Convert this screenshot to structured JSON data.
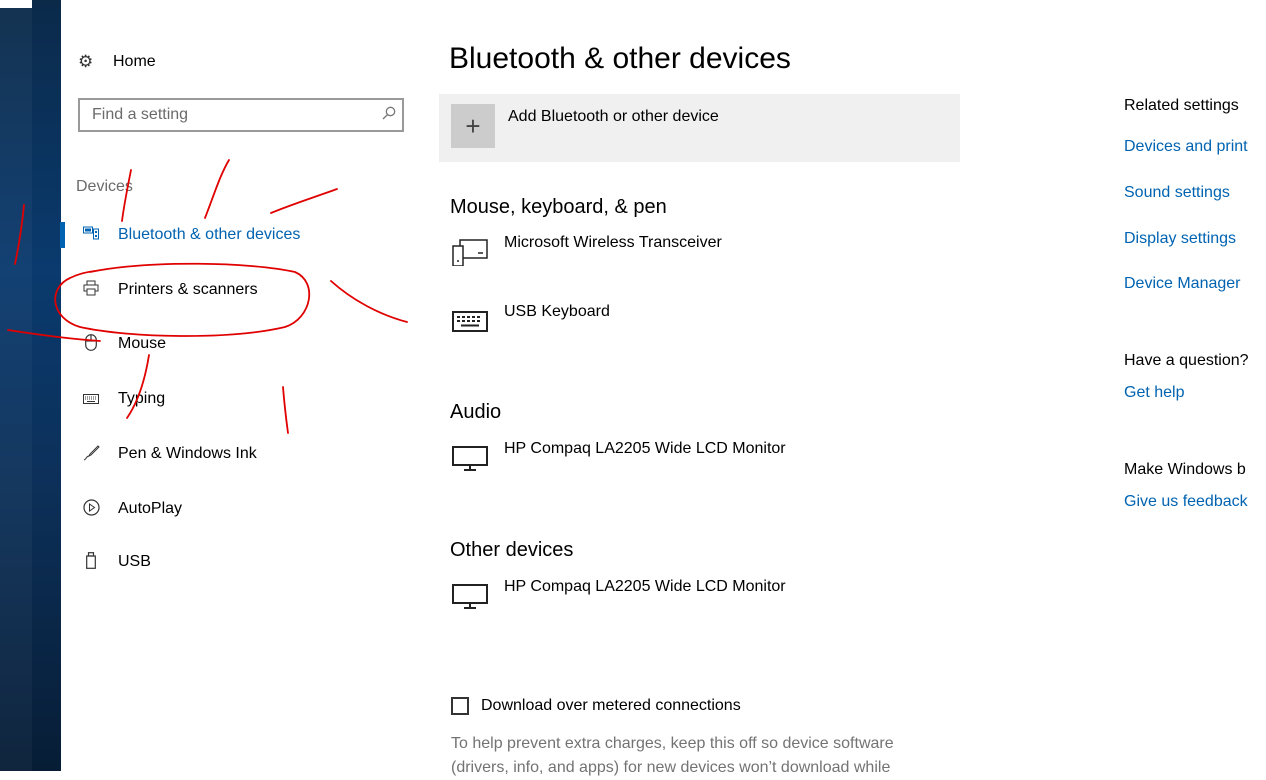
{
  "sidebar": {
    "home_label": "Home",
    "search": {
      "placeholder": "Find a setting",
      "value": ""
    },
    "group_label": "Devices",
    "items": [
      {
        "label": "Bluetooth & other devices",
        "icon": "bluetooth-devices-icon",
        "active": true
      },
      {
        "label": "Printers & scanners",
        "icon": "printer-icon",
        "active": false
      },
      {
        "label": "Mouse",
        "icon": "mouse-icon",
        "active": false
      },
      {
        "label": "Typing",
        "icon": "keyboard-icon",
        "active": false
      },
      {
        "label": "Pen & Windows Ink",
        "icon": "pen-icon",
        "active": false
      },
      {
        "label": "AutoPlay",
        "icon": "autoplay-icon",
        "active": false
      },
      {
        "label": "USB",
        "icon": "usb-icon",
        "active": false
      }
    ]
  },
  "main": {
    "title": "Bluetooth & other devices",
    "add_device_label": "Add Bluetooth or other device",
    "sections": [
      {
        "heading": "Mouse, keyboard, & pen",
        "devices": [
          {
            "name": "Microsoft Wireless Transceiver",
            "icon": "transceiver-icon"
          },
          {
            "name": "USB Keyboard",
            "icon": "keyboard-icon"
          }
        ]
      },
      {
        "heading": "Audio",
        "devices": [
          {
            "name": "HP Compaq LA2205 Wide LCD Monitor",
            "icon": "monitor-icon"
          }
        ]
      },
      {
        "heading": "Other devices",
        "devices": [
          {
            "name": "HP Compaq LA2205 Wide LCD Monitor",
            "icon": "monitor-icon"
          }
        ]
      }
    ],
    "metered": {
      "label": "Download over metered connections",
      "checked": false,
      "help_line1": "To help prevent extra charges, keep this off so device software",
      "help_line2": "(drivers, info, and apps) for new devices won’t download while"
    }
  },
  "related": {
    "heading": "Related settings",
    "links": [
      "Devices and print",
      "Sound settings",
      "Display settings",
      "Device Manager"
    ],
    "question_heading": "Have a question?",
    "question_link": "Get help",
    "feedback_heading": "Make Windows b",
    "feedback_link": "Give us feedback"
  },
  "colors": {
    "accent": "#0063b1",
    "annotation": "#e00000"
  }
}
